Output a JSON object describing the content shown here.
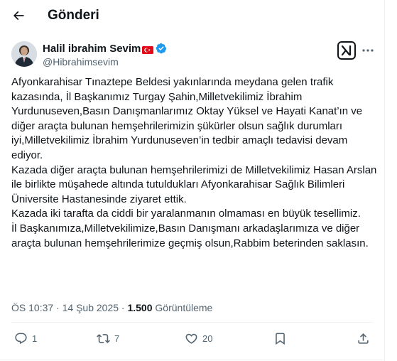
{
  "header": {
    "title": "Gönderi",
    "back_icon": "arrow-left-icon"
  },
  "author": {
    "name": "Halil ibrahim Sevim",
    "handle": "@Hibrahimsevim",
    "verified": true,
    "verified_color": "#1d9bf0",
    "flag_icon": "turkey-flag-icon"
  },
  "tweet": {
    "paragraphs": [
      "Afyonkarahisar Tınaztepe Beldesi yakınlarında meydana gelen trafik kazasında, İl Başkanımız Turgay Şahin,Milletvekilimiz İbrahim Yurdunuseven,Basın Danışmanlarımız Oktay Yüksel ve Hayati Kanat’ın ve diğer araçta bulunan hemşehrilerimizin şükürler olsun sağlık durumları iyi,Milletvekilimiz İbrahim Yurdunuseven’in tedbir amaçlı tedavisi devam ediyor.",
      "Kazada diğer araçta bulunan hemşehrilerimizi de Milletvekilimiz Hasan Arslan ile birlikte müşahede altında tutuldukları Afyonkarahisar Sağlık Bilimleri Üniversite Hastanesinde ziyaret ettik.",
      "Kazada iki tarafta da ciddi bir yaralanmanın olmaması en büyük tesellimiz.",
      "İl Başkanımıza,Milletvekilimize,Basın Danışmanı arkadaşlarımıza ve diğer araçta bulunan hemşehrilerimize geçmiş olsun,Rabbim beterinden saklasın."
    ],
    "time": "ÖS 10:37",
    "separator": "·",
    "date": "14 Şub 2025",
    "views_count": "1.500",
    "views_label": "Görüntüleme"
  },
  "actions": {
    "replies": "1",
    "reposts": "7",
    "likes": "20"
  },
  "colors": {
    "text": "#0f1419",
    "secondary": "#536471",
    "divider": "#eff3f4",
    "accent": "#1d9bf0"
  }
}
